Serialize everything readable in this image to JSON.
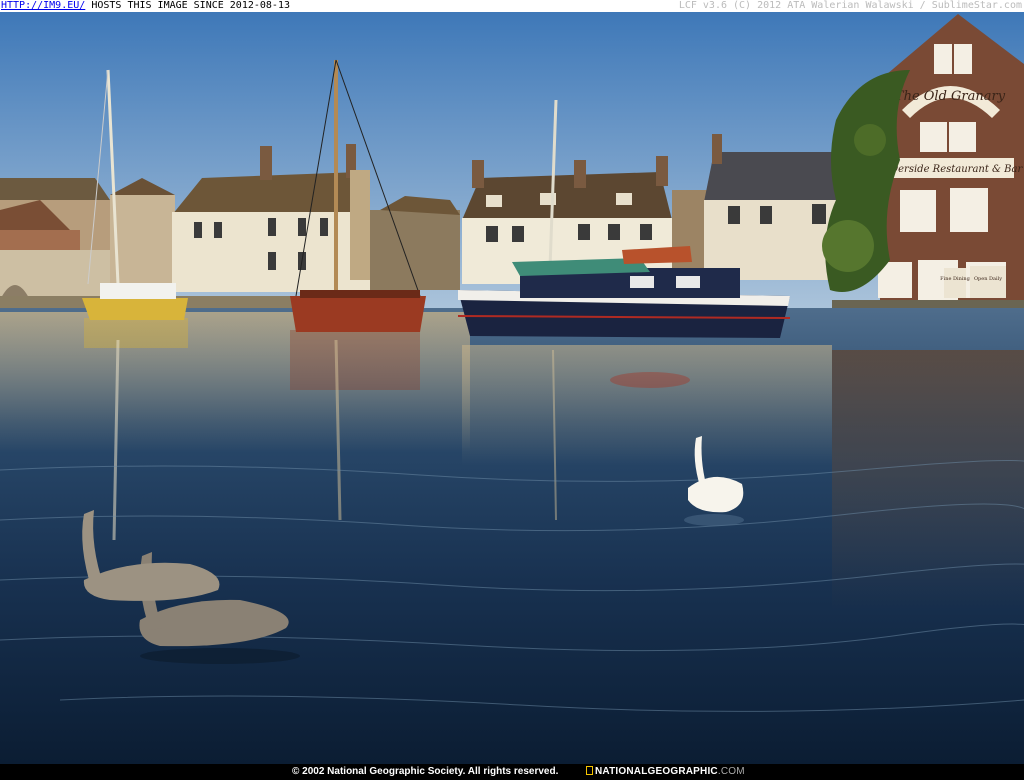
{
  "header": {
    "link_text": "HTTP://IM9.EU/",
    "hosts_text": " HOSTS THIS IMAGE SINCE 2012-08-13",
    "version_text": "LCF v3.6 (C) 2012 ATA Walerian Walawski / SublimeStar.com"
  },
  "photo": {
    "signs": {
      "granary": "The Old Granary",
      "restaurant": "Riverside Restaurant & Bar",
      "notice_left": "Fine Dining",
      "notice_right": "Open Daily"
    }
  },
  "footer": {
    "copyright": "© 2002 National Geographic Society. All rights reserved.",
    "brand": "NATIONALGEOGRAPHIC",
    "brand_suffix": ".COM"
  },
  "colors": {
    "sky_top": "#3e78b8",
    "sky_bottom": "#b3c9dd",
    "water_dark": "#0b1d33",
    "brick": "#7a4a35",
    "ivy": "#3a5a22",
    "accent_yellow": "#f5c400"
  }
}
